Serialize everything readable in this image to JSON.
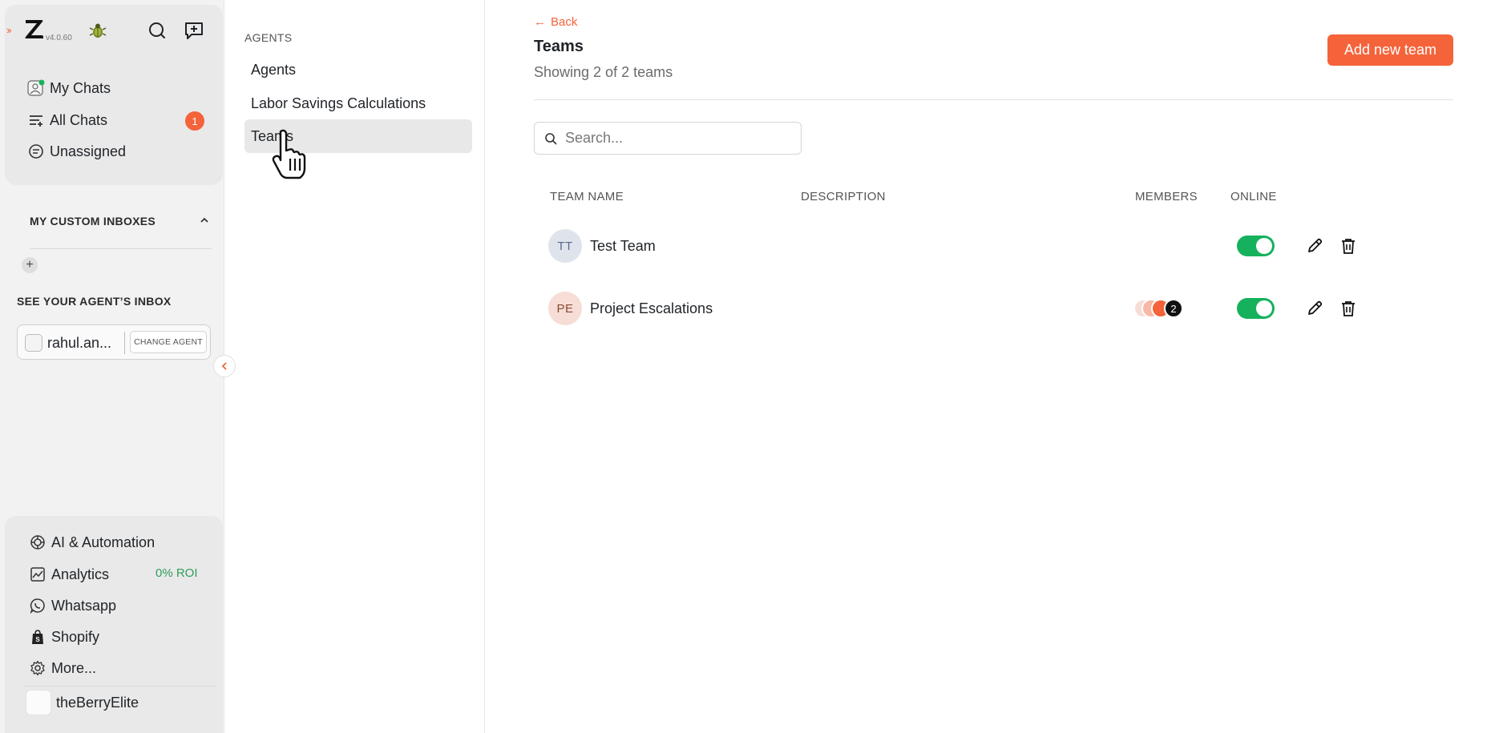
{
  "app": {
    "version": "v4.0.60"
  },
  "sidebar": {
    "nav": [
      {
        "label": "My Chats",
        "icon": "agent-avatar-icon"
      },
      {
        "label": "All Chats",
        "icon": "filter-list-icon",
        "badge": "1"
      },
      {
        "label": "Unassigned",
        "icon": "chat-bubble-icon"
      }
    ],
    "custom_inboxes_title": "MY CUSTOM INBOXES",
    "add_inbox_label": "+",
    "agent_inbox_title": "SEE YOUR AGENT’S INBOX",
    "agent_name": "rahul.an...",
    "change_agent_label": "CHANGE AGENT",
    "bottom_nav": [
      {
        "label": "AI & Automation",
        "icon": "ai-sparkle-icon"
      },
      {
        "label": "Analytics",
        "icon": "analytics-chart-icon",
        "extra": "0% ROI"
      },
      {
        "label": "Whatsapp",
        "icon": "whatsapp-icon"
      },
      {
        "label": "Shopify",
        "icon": "shopify-bag-icon"
      },
      {
        "label": "More...",
        "icon": "gear-icon"
      }
    ],
    "org_name": "theBerryElite"
  },
  "submenu": {
    "heading": "AGENTS",
    "items": [
      {
        "label": "Agents",
        "active": false
      },
      {
        "label": "Labor Savings Calculations",
        "active": false
      },
      {
        "label": "Teams",
        "active": true
      }
    ]
  },
  "main": {
    "back_label": "Back",
    "title": "Teams",
    "subtitle": "Showing 2 of 2 teams",
    "add_button_label": "Add new team",
    "search_placeholder": "Search...",
    "columns": [
      "TEAM NAME",
      "DESCRIPTION",
      "MEMBERS",
      "ONLINE"
    ],
    "teams": [
      {
        "initials": "TT",
        "name": "Test Team",
        "description": "",
        "members_count": "",
        "online": true,
        "avatar_bg": "#dfe3ec",
        "avatar_fg": "#5b6a8c"
      },
      {
        "initials": "PE",
        "name": "Project Escalations",
        "description": "",
        "members_count": "2",
        "online": true,
        "avatar_bg": "#f6ddd5",
        "avatar_fg": "#8a4a36"
      }
    ]
  },
  "colors": {
    "accent": "#f4633a",
    "toggle_on": "#15b15d",
    "roi_green": "#2e9e5b"
  }
}
